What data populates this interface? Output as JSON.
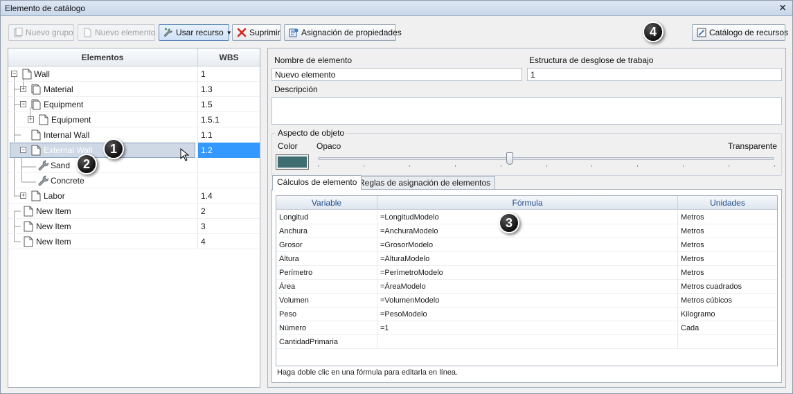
{
  "window": {
    "title": "Elemento de catálogo"
  },
  "toolbar": {
    "new_group": "Nuevo grupo",
    "new_item": "Nuevo elemento",
    "use_resource": "Usar recurso",
    "delete": "Suprimir",
    "assign_properties": "Asignación de propiedades",
    "resource_catalog": "Catálogo de recursos"
  },
  "callouts": [
    "1",
    "2",
    "3",
    "4"
  ],
  "tree": {
    "col_elements": "Elementos",
    "col_wbs": "WBS",
    "rows": [
      {
        "label": "Wall",
        "wbs": "1"
      },
      {
        "label": "Material",
        "wbs": "1.3"
      },
      {
        "label": "Equipment",
        "wbs": "1.5"
      },
      {
        "label": "Equipment",
        "wbs": "1.5.1"
      },
      {
        "label": "Internal Wall",
        "wbs": "1.1"
      },
      {
        "label": "External Wall",
        "wbs": "1.2"
      },
      {
        "label": "Sand",
        "wbs": ""
      },
      {
        "label": "Concrete",
        "wbs": ""
      },
      {
        "label": "Labor",
        "wbs": "1.4"
      },
      {
        "label": "New Item",
        "wbs": "2"
      },
      {
        "label": "New Item",
        "wbs": "3"
      },
      {
        "label": "New Item",
        "wbs": "4"
      }
    ]
  },
  "form": {
    "name_label": "Nombre de elemento",
    "name_value": "Nuevo elemento",
    "wbs_label": "Estructura de desglose de trabajo",
    "wbs_value": "1",
    "description_label": "Descripción",
    "description_value": "",
    "appearance_label": "Aspecto de objeto",
    "color_label": "Color",
    "opaque_label": "Opaco",
    "transparent_label": "Transparente",
    "transparency_level": 0.42,
    "swatch_color": "#3f6e72"
  },
  "tabs": {
    "calculations": "Cálculos de elemento",
    "assignment_rules": "Reglas de asignación de elementos"
  },
  "grid": {
    "columns": [
      "Variable",
      "Fórmula",
      "Unidades"
    ],
    "rows": [
      [
        "Longitud",
        "=LongitudModelo",
        "Metros"
      ],
      [
        "Anchura",
        "=AnchuraModelo",
        "Metros"
      ],
      [
        "Grosor",
        "=GrosorModelo",
        "Metros"
      ],
      [
        "Altura",
        "=AlturaModelo",
        "Metros"
      ],
      [
        "Perímetro",
        "=PerímetroModelo",
        "Metros"
      ],
      [
        "Área",
        "=ÁreaModelo",
        "Metros cuadrados"
      ],
      [
        "Volumen",
        "=VolumenModelo",
        "Metros cúbicos"
      ],
      [
        "Peso",
        "=PesoModelo",
        "Kilogramo"
      ],
      [
        "Número",
        "=1",
        "Cada"
      ],
      [
        "CantidadPrimaria",
        "",
        ""
      ]
    ]
  },
  "hint": "Haga doble clic en una fórmula para editarla en línea."
}
